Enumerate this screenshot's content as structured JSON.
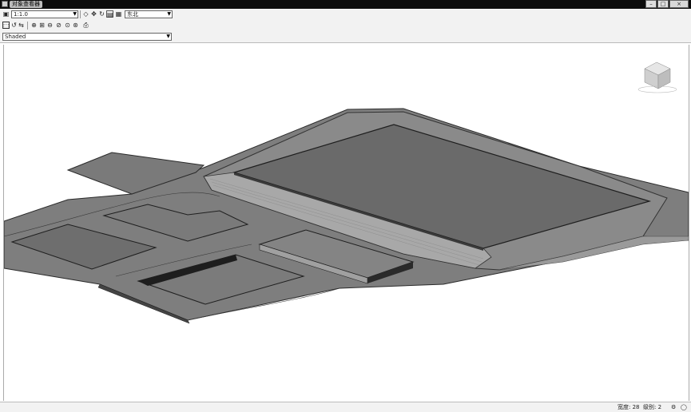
{
  "window": {
    "title": "对象查看器",
    "minimize_glyph": "–",
    "maximize_glyph": "□",
    "close_glyph": "×"
  },
  "toolbar1": {
    "scale_value": "1:1.0",
    "view_value": "东北"
  },
  "toolbar3": {
    "style_value": "Shaded"
  },
  "statusbar": {
    "zoom_text": "宽度: 28",
    "count_text": "级别: 2"
  },
  "icons": {
    "print": "printer-icon",
    "nav_cube": "viewcube-icon"
  }
}
